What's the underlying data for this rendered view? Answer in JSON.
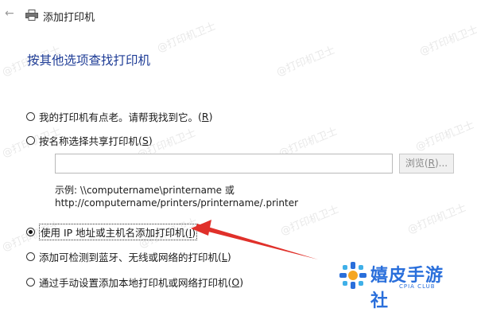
{
  "window": {
    "title": "添加打印机"
  },
  "page": {
    "heading": "按其他选项查找打印机"
  },
  "options": [
    {
      "label": "我的打印机有点老。请帮我找到它。",
      "accel": "R",
      "selected": false
    },
    {
      "label": "按名称选择共享打印机",
      "accel": "S",
      "selected": false
    },
    {
      "label": "使用 IP 地址或主机名添加打印机",
      "accel": "I",
      "selected": true
    },
    {
      "label": "添加可检测到蓝牙、无线或网络的打印机",
      "accel": "L",
      "selected": false
    },
    {
      "label": "通过手动设置添加本地打印机或网络打印机",
      "accel": "O",
      "selected": false
    }
  ],
  "shared": {
    "input_value": "",
    "browse_label": "浏览",
    "browse_accel": "R",
    "example_line1": "示例: \\\\computername\\printername 或",
    "example_line2": "http://computername/printers/printername/.printer"
  },
  "watermark": "@打印机卫士",
  "logo": {
    "text": "嬉皮手游社",
    "sub": "CPIA CLUB"
  },
  "colors": {
    "heading": "#1e3c96",
    "arrow": "#e0302a",
    "logo": "#2a6fdb"
  }
}
